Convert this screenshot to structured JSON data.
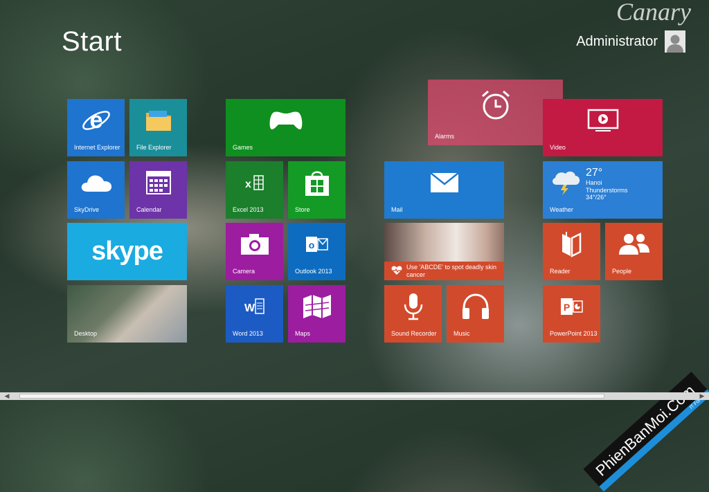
{
  "start": {
    "title": "Start"
  },
  "user": {
    "name": "Administrator"
  },
  "brand": {
    "text": "Canary"
  },
  "tiles": {
    "internet_explorer": "Internet Explorer",
    "file_explorer": "File Explorer",
    "skydrive": "SkyDrive",
    "calendar": "Calendar",
    "skype": "skype",
    "desktop": "Desktop",
    "games": "Games",
    "excel": "Excel 2013",
    "store": "Store",
    "camera": "Camera",
    "outlook": "Outlook 2013",
    "word": "Word 2013",
    "maps": "Maps",
    "alarms": "Alarms",
    "mail": "Mail",
    "health": "Use 'ABCDE' to spot deadly skin cancer",
    "sound_recorder": "Sound Recorder",
    "music": "Music",
    "video": "Video",
    "weather": {
      "label": "Weather",
      "temp": "27°",
      "city": "Hanoi",
      "condition": "Thunderstorms",
      "range": "34°/26°"
    },
    "reader": "Reader",
    "people": "People",
    "powerpoint": "PowerPoint 2013"
  },
  "watermark": {
    "site": "PhienBanMoi.Com",
    "tag": "IT Forum"
  },
  "colors": {
    "blue": "#1e74cf",
    "teal": "#1a8f9a",
    "purple": "#6d33a8",
    "skype": "#1aabe0",
    "green": "#0f8f1f",
    "excel_green": "#1b7f2c",
    "store_green": "#149b25",
    "magenta": "#9c1da0",
    "outlook_blue": "#0d6cc0",
    "word_blue": "#1d5bc4",
    "alarm_red": "#cf2955",
    "mail_blue": "#1e7bd0",
    "orange": "#d24a2c",
    "video_red": "#c21a43",
    "weather_blue": "#2b7fd4"
  }
}
